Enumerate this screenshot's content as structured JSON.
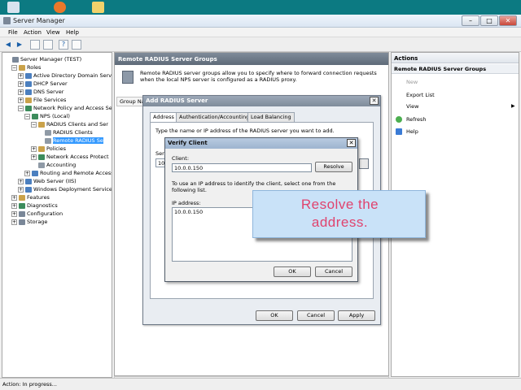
{
  "window": {
    "title": "Server Manager",
    "minimize": "–",
    "maximize": "□",
    "close": "✕"
  },
  "menu": [
    "File",
    "Action",
    "View",
    "Help"
  ],
  "tree": [
    {
      "label": "Server Manager (TEST)",
      "level": 0,
      "expander": ""
    },
    {
      "label": "Roles",
      "level": 1,
      "expander": "−"
    },
    {
      "label": "Active Directory Domain Servic",
      "level": 2,
      "expander": "+"
    },
    {
      "label": "DHCP Server",
      "level": 2,
      "expander": "+"
    },
    {
      "label": "DNS Server",
      "level": 2,
      "expander": "+"
    },
    {
      "label": "File Services",
      "level": 2,
      "expander": "+"
    },
    {
      "label": "Network Policy and Access Ser",
      "level": 2,
      "expander": "−"
    },
    {
      "label": "NPS (Local)",
      "level": 3,
      "expander": "−"
    },
    {
      "label": "RADIUS Clients and Ser",
      "level": 4,
      "expander": "−"
    },
    {
      "label": "RADIUS Clients",
      "level": 5,
      "expander": ""
    },
    {
      "label": "Remote RADIUS Se",
      "level": 5,
      "expander": "",
      "selected": true
    },
    {
      "label": "Policies",
      "level": 4,
      "expander": "+"
    },
    {
      "label": "Network Access Protect",
      "level": 4,
      "expander": "+"
    },
    {
      "label": "Accounting",
      "level": 4,
      "expander": ""
    },
    {
      "label": "Routing and Remote Access",
      "level": 3,
      "expander": "+"
    },
    {
      "label": "Web Server (IIS)",
      "level": 2,
      "expander": "+"
    },
    {
      "label": "Windows Deployment Services",
      "level": 2,
      "expander": "+"
    },
    {
      "label": "Features",
      "level": 1,
      "expander": "+"
    },
    {
      "label": "Diagnostics",
      "level": 1,
      "expander": "+"
    },
    {
      "label": "Configuration",
      "level": 1,
      "expander": "+"
    },
    {
      "label": "Storage",
      "level": 1,
      "expander": "+"
    }
  ],
  "center": {
    "header": "Remote RADIUS Server Groups",
    "description": "Remote RADIUS server groups allow you to specify where to forward connection requests when the local NPS server is configured as a RADIUS proxy.",
    "group_column": "Group Na"
  },
  "actions": {
    "header": "Actions",
    "subheader": "Remote RADIUS Server Groups",
    "items": [
      {
        "label": "New",
        "enabled": false
      },
      {
        "label": "Export List",
        "enabled": true
      },
      {
        "label": "View",
        "enabled": true,
        "submenu": "▶"
      },
      {
        "label": "Refresh",
        "enabled": true
      },
      {
        "label": "Help",
        "enabled": true
      }
    ]
  },
  "add_dialog": {
    "title": "Add RADIUS Server",
    "tabs": [
      "Address",
      "Authentication/Accounting",
      "Load Balancing"
    ],
    "instruction": "Type the name or IP address of the RADIUS server you want to add.",
    "server_label_cut": "Ser",
    "server_value_cut": "10",
    "ok": "OK",
    "cancel": "Cancel",
    "apply": "Apply"
  },
  "verify_dialog": {
    "title": "Verify Client",
    "client_label": "Client:",
    "client_value": "10.0.0.150",
    "resolve": "Resolve",
    "hint": "To use an IP address to identify the client, select one from the following list.",
    "ip_label": "IP address:",
    "ip_items": [
      "10.0.0.150"
    ],
    "ok": "OK",
    "cancel": "Cancel"
  },
  "callout": {
    "line1": "Resolve the",
    "line2": "address."
  },
  "status": "Action:  In progress...",
  "colors": {
    "taskbar": "#0c7a82",
    "accent": "#3399ff",
    "callout_text": "#e0436e",
    "callout_bg": "#c9e2f8"
  }
}
